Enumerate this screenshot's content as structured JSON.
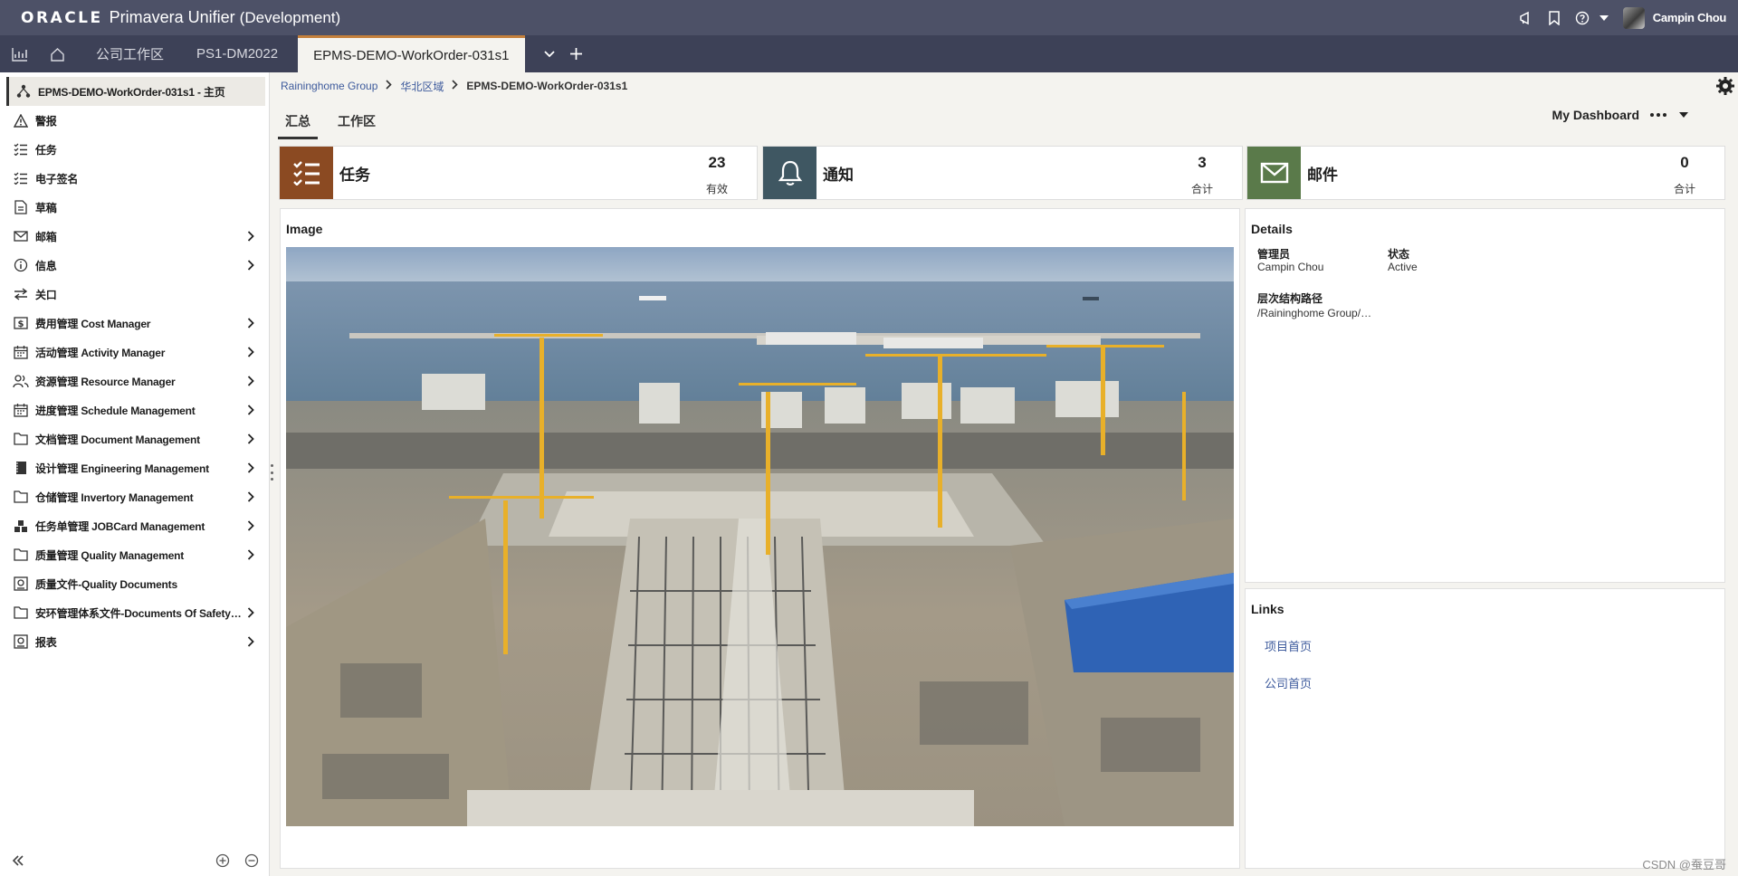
{
  "app": {
    "brand": "ORACLE",
    "product": "Primavera Unifier",
    "environment": "(Development)",
    "user_name": "Campin Chou"
  },
  "tabs": [
    {
      "label": "公司工作区"
    },
    {
      "label": "PS1-DM2022"
    },
    {
      "label": "EPMS-DEMO-WorkOrder-031s1"
    }
  ],
  "nav": {
    "home_item": "EPMS-DEMO-WorkOrder-031s1 - 主页",
    "items": [
      {
        "label": "警报"
      },
      {
        "label": "任务"
      },
      {
        "label": "电子签名"
      },
      {
        "label": "草稿"
      },
      {
        "label": "邮箱"
      },
      {
        "label": "信息"
      },
      {
        "label": "关口"
      },
      {
        "label": "费用管理 Cost Manager"
      },
      {
        "label": "活动管理 Activity Manager"
      },
      {
        "label": "资源管理 Resource Manager"
      },
      {
        "label": "进度管理 Schedule Management"
      },
      {
        "label": "文档管理 Document Management"
      },
      {
        "label": "设计管理 Engineering Management"
      },
      {
        "label": "仓储管理 Invertory Management"
      },
      {
        "label": "任务单管理 JOBCard Management"
      },
      {
        "label": "质量管理 Quality Management"
      },
      {
        "label": "质量文件-Quality Documents"
      },
      {
        "label": "安环管理体系文件-Documents Of Safety and Environment"
      },
      {
        "label": "报表"
      }
    ]
  },
  "breadcrumb": {
    "items": [
      "Raininghome Group",
      "华北区域"
    ],
    "current": "EPMS-DEMO-WorkOrder-031s1"
  },
  "subtabs": [
    "汇总",
    "工作区"
  ],
  "dashboard": {
    "label": "My Dashboard"
  },
  "cards": [
    {
      "title": "任务",
      "count": "23",
      "sub": "有效",
      "color": "#8b4a22"
    },
    {
      "title": "通知",
      "count": "3",
      "sub": "合计",
      "color": "#3f5762"
    },
    {
      "title": "邮件",
      "count": "0",
      "sub": "合计",
      "color": "#5a7a4a"
    }
  ],
  "image_panel": {
    "title": "Image"
  },
  "details": {
    "title": "Details",
    "manager_label": "管理员",
    "manager_value": "Campin Chou",
    "status_label": "状态",
    "status_value": "Active",
    "path_label": "层次结构路径",
    "path_value": "/Raininghome Group/华北区域"
  },
  "links": {
    "title": "Links",
    "items": [
      "项目首页",
      "公司首页"
    ]
  },
  "watermark": "CSDN @蚕豆哥"
}
